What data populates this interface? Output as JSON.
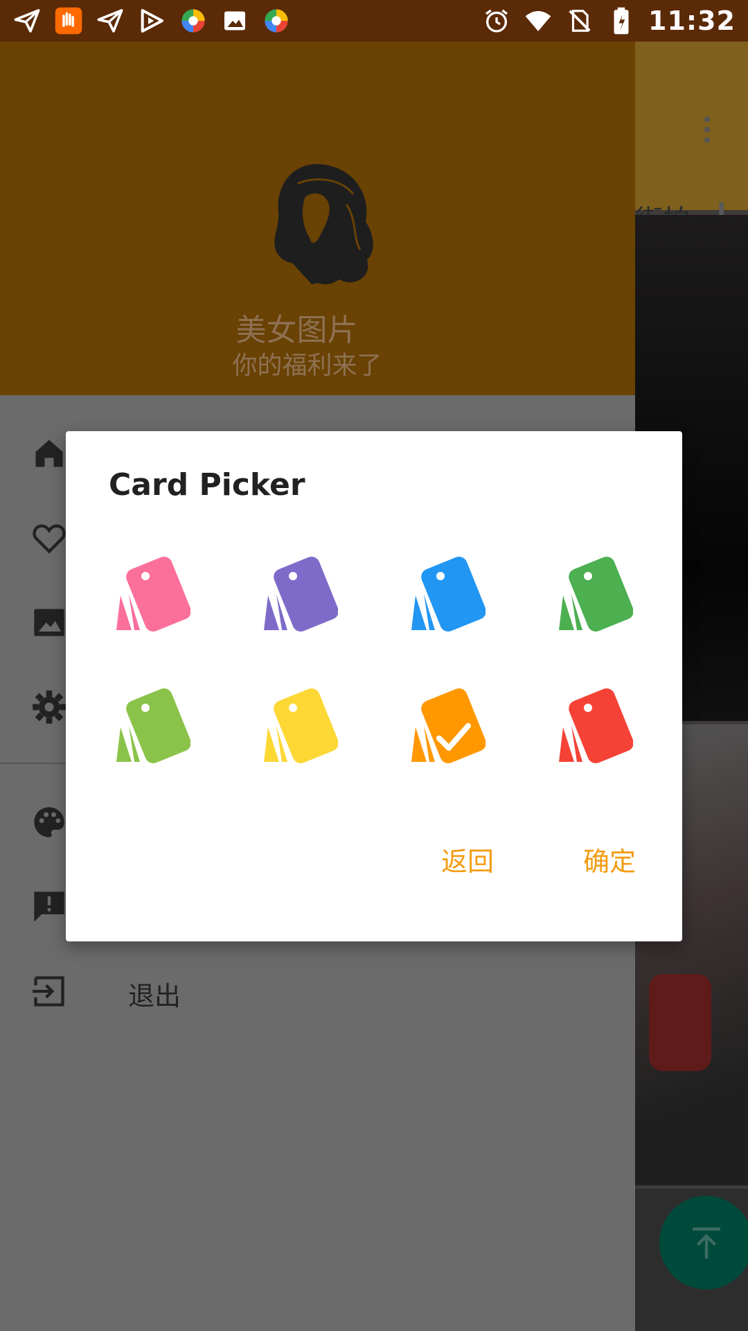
{
  "status_bar": {
    "time": "11:32",
    "left_icons": [
      "send-icon",
      "hand-app-icon",
      "send-icon",
      "play-store-icon",
      "colorful-app-icon",
      "image-icon",
      "colorful-app-icon"
    ],
    "right_icons": [
      "alarm-icon",
      "wifi-icon",
      "no-sim-icon",
      "battery-icon"
    ]
  },
  "background_app": {
    "tab_label": "街拍",
    "add_icon": "plus-icon",
    "menu_icon": "more-vert-icon",
    "fab_icon": "arrow-up-icon"
  },
  "drawer": {
    "header_title": "美女图片",
    "header_subtitle": "你的福利来了",
    "items": [
      {
        "icon": "home-icon",
        "label": ""
      },
      {
        "icon": "heart-icon",
        "label": ""
      },
      {
        "icon": "image-icon",
        "label": ""
      },
      {
        "icon": "settings-icon",
        "label": ""
      },
      {
        "icon": "palette-icon",
        "label": ""
      },
      {
        "icon": "feedback-icon",
        "label": ""
      },
      {
        "icon": "exit-icon",
        "label": "退出"
      }
    ]
  },
  "dialog": {
    "title": "Card Picker",
    "cards": [
      {
        "color": "#FB6F9B",
        "selected": false
      },
      {
        "color": "#7E6BC9",
        "selected": false
      },
      {
        "color": "#2196F3",
        "selected": false
      },
      {
        "color": "#4CAF50",
        "selected": false
      },
      {
        "color": "#8BC34A",
        "selected": false
      },
      {
        "color": "#FDD835",
        "selected": false
      },
      {
        "color": "#FF9800",
        "selected": true
      },
      {
        "color": "#F44336",
        "selected": false
      }
    ],
    "cancel_label": "返回",
    "confirm_label": "确定",
    "accent": "#F39C12"
  }
}
